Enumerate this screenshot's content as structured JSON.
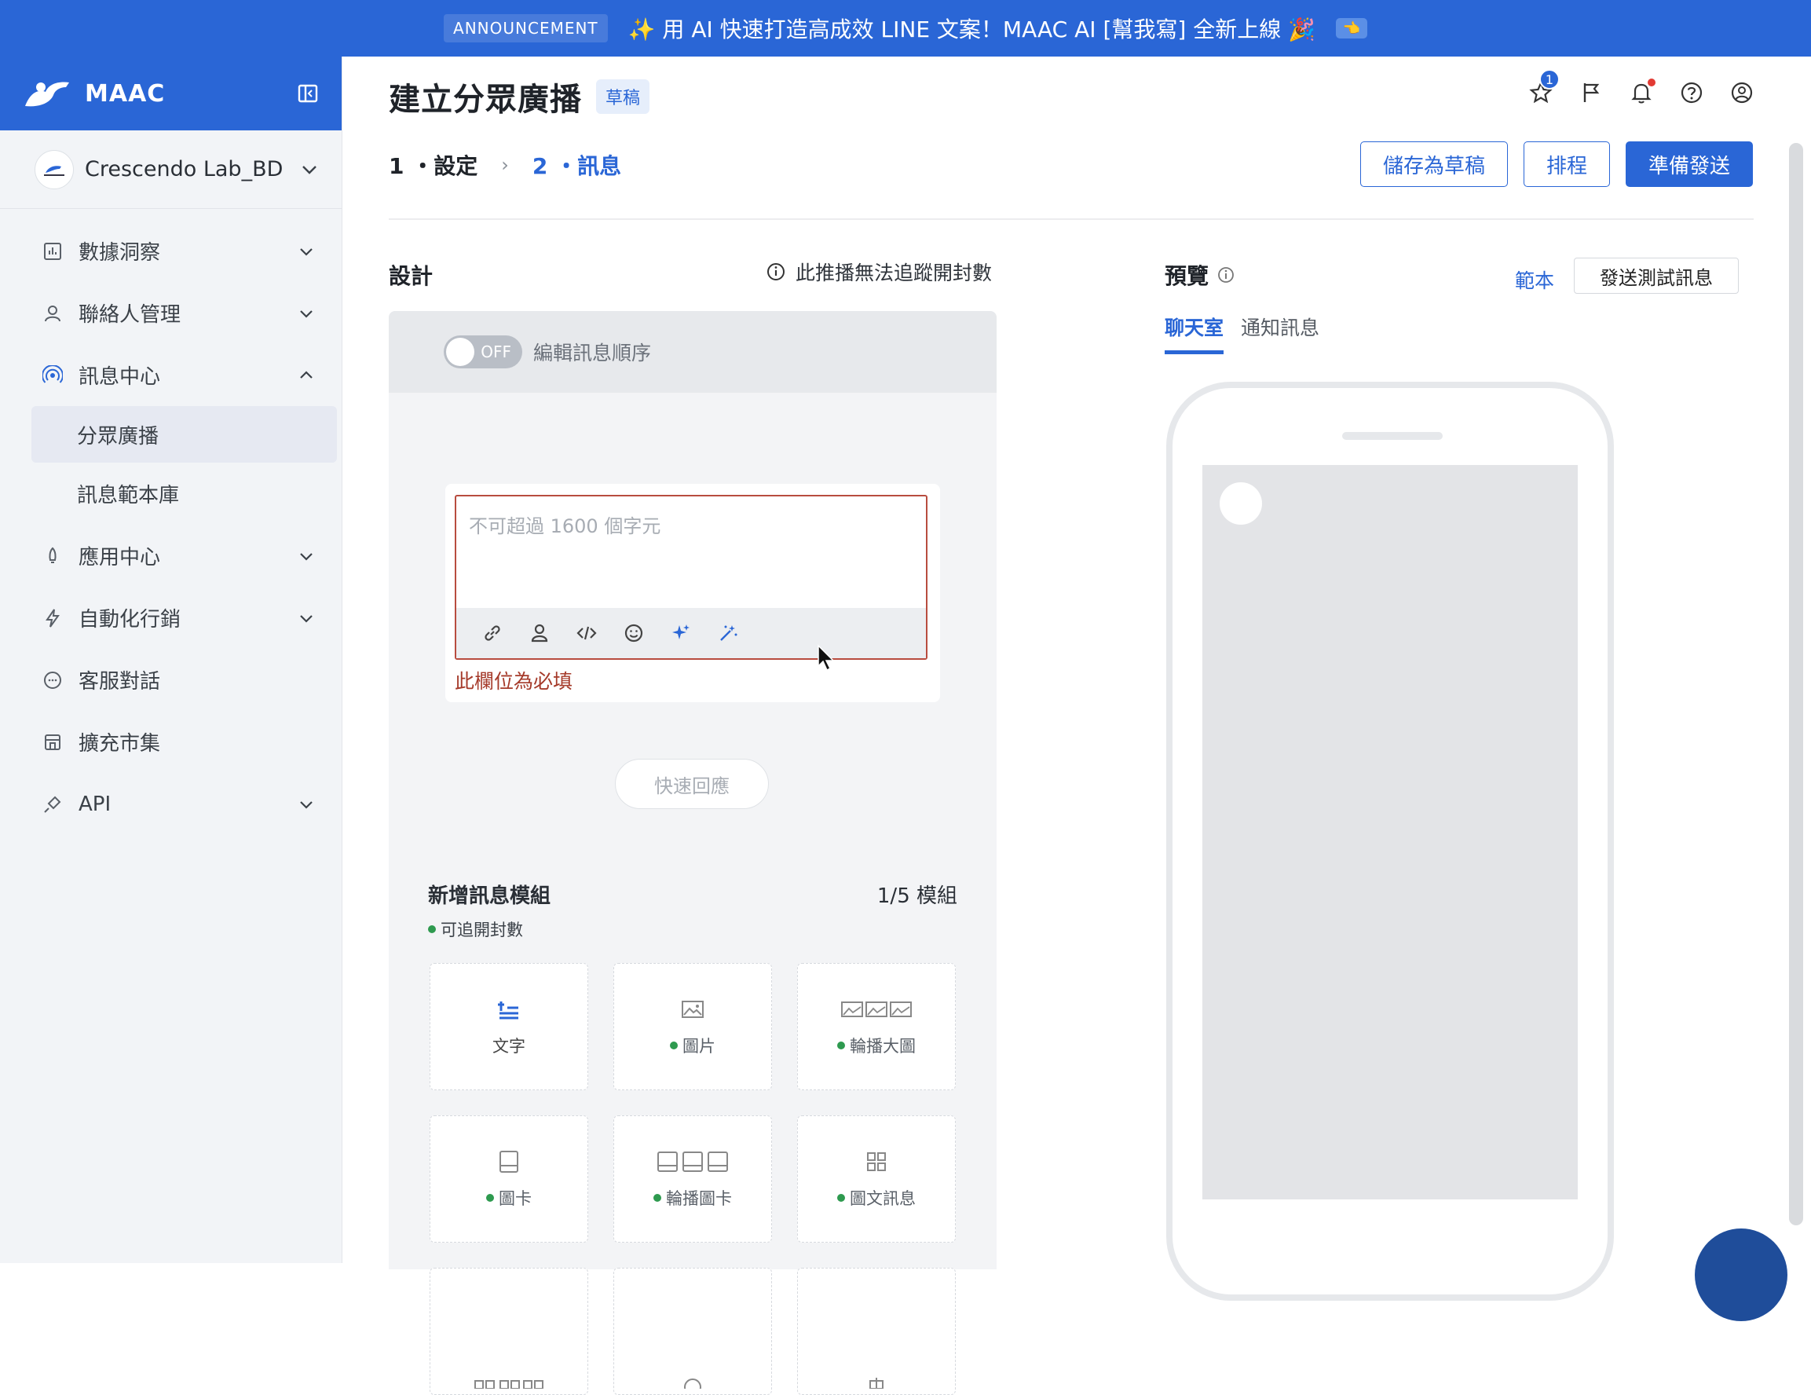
{
  "announcement": {
    "tag": "ANNOUNCEMENT",
    "text": "✨ 用 AI 快速打造高成效 LINE 文案！MAAC AI [幫我寫] 全新上線 🎉",
    "badge": "👈"
  },
  "sidebar": {
    "brand": "MAAC",
    "account": "Crescendo Lab_BD",
    "items": [
      {
        "label": "數據洞察",
        "icon": "chart-icon",
        "expand": "down"
      },
      {
        "label": "聯絡人管理",
        "icon": "user-icon",
        "expand": "down"
      },
      {
        "label": "訊息中心",
        "icon": "broadcast-icon",
        "expand": "up"
      },
      {
        "label": "分眾廣播",
        "sub": true,
        "active": true
      },
      {
        "label": "訊息範本庫",
        "sub": true
      },
      {
        "label": "應用中心",
        "icon": "rocket-icon",
        "expand": "down"
      },
      {
        "label": "自動化行銷",
        "icon": "lightning-icon",
        "expand": "down"
      },
      {
        "label": "客服對話",
        "icon": "chat-icon"
      },
      {
        "label": "擴充市集",
        "icon": "store-icon"
      },
      {
        "label": "API",
        "icon": "plug-icon",
        "expand": "down"
      }
    ]
  },
  "header": {
    "title": "建立分眾廣播",
    "draft_badge": "草稿",
    "star_count": "1"
  },
  "steps": {
    "step1": "1 ・設定",
    "step2": "2 ・訊息"
  },
  "actions": {
    "save_draft": "儲存為草稿",
    "schedule": "排程",
    "ready_send": "準備發送"
  },
  "design": {
    "title": "設計",
    "tracking_note": "此推播無法追蹤開封數",
    "toggle_state": "OFF",
    "toggle_label": "編輯訊息順序",
    "editor_placeholder": "不可超過 1600 個字元",
    "error_text": "此欄位為必填",
    "quick_reply": "快速回應",
    "add_module_title": "新增訊息模組",
    "module_count": "1/5 模組",
    "trackable_note": "可追開封數",
    "modules": [
      {
        "label": "文字",
        "icon": "text-icon",
        "trackable": false
      },
      {
        "label": "圖片",
        "icon": "image-icon",
        "trackable": true
      },
      {
        "label": "輪播大圖",
        "icon": "carousel-image-icon",
        "trackable": true
      },
      {
        "label": "圖卡",
        "icon": "card-icon",
        "trackable": true
      },
      {
        "label": "輪播圖卡",
        "icon": "carousel-card-icon",
        "trackable": true
      },
      {
        "label": "圖文訊息",
        "icon": "imagemap-icon",
        "trackable": true
      }
    ]
  },
  "preview": {
    "title": "預覽",
    "sample": "範本",
    "send_test": "發送測試訊息",
    "tabs": [
      "聊天室",
      "通知訊息"
    ]
  }
}
